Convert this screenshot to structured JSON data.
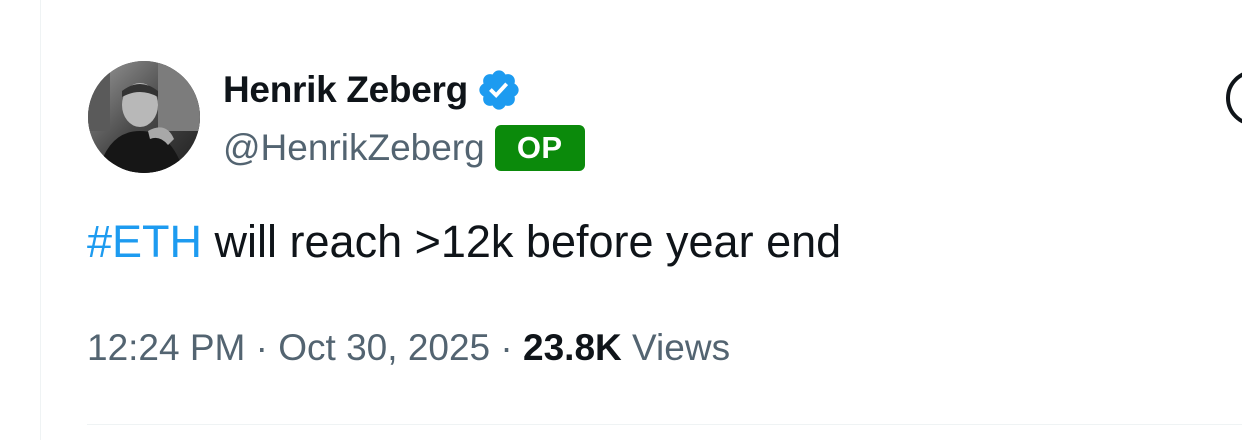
{
  "author": {
    "display_name": "Henrik Zeberg",
    "handle": "@HenrikZeberg",
    "badge": "OP",
    "verified": true
  },
  "tweet": {
    "hashtag": "#ETH",
    "text": " will reach >12k before year end"
  },
  "meta": {
    "time": "12:24 PM",
    "separator": " · ",
    "date": "Oct 30, 2025",
    "views_count": "23.8K",
    "views_label": " Views"
  },
  "colors": {
    "hashtag": "#1d9bf0",
    "verified": "#1d9bf0",
    "badge_bg": "#0b8a0b",
    "secondary_text": "#536471",
    "primary_text": "#0f1419"
  },
  "icons": {
    "verified": "verified-badge-icon"
  }
}
